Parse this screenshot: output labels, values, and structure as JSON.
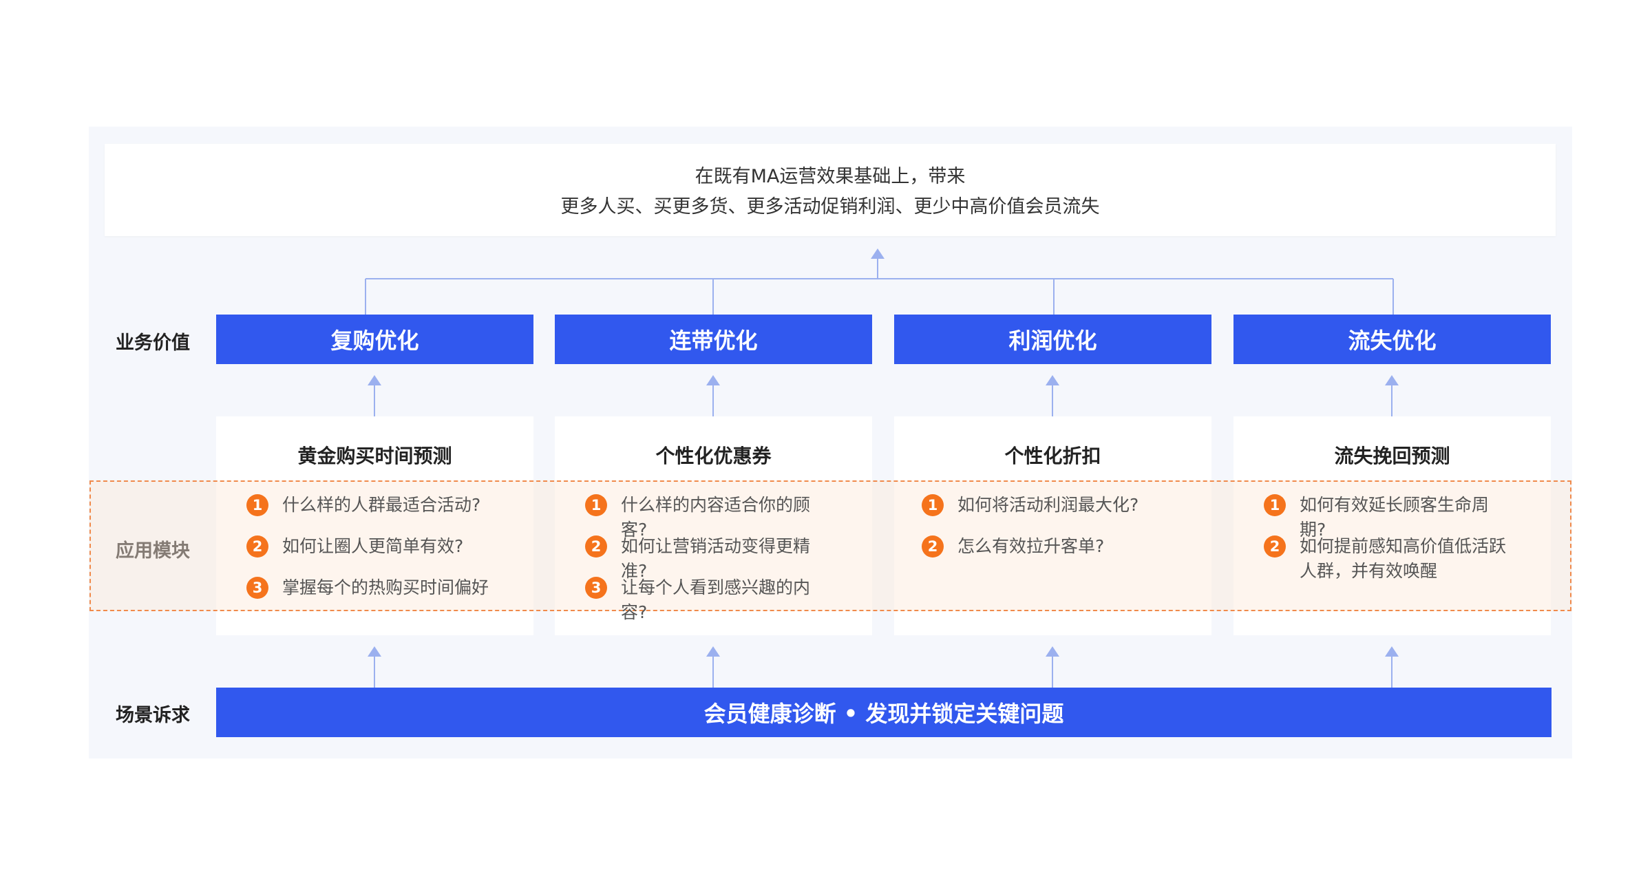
{
  "top": {
    "line1": "在既有MA运营效果基础上，带来",
    "line2": "更多人买、买更多货、更多活动促销利润、更少中高价值会员流失"
  },
  "row_labels": {
    "business_value": "业务价值",
    "app_module": "应用模块",
    "scenario": "场景诉求"
  },
  "value_boxes": [
    "复购优化",
    "连带优化",
    "利润优化",
    "流失优化"
  ],
  "modules": [
    {
      "title": "黄金购买时间预测",
      "items": [
        {
          "num": "1",
          "text": "什么样的人群最适合活动?"
        },
        {
          "num": "2",
          "text": "如何让圈人更简单有效?"
        },
        {
          "num": "3",
          "text": "掌握每个的热购买时间偏好"
        }
      ]
    },
    {
      "title": "个性化优惠券",
      "items": [
        {
          "num": "1",
          "text": "什么样的内容适合你的顾客?"
        },
        {
          "num": "2",
          "text": "如何让营销活动变得更精准?"
        },
        {
          "num": "3",
          "text": "让每个人看到感兴趣的内容?"
        }
      ]
    },
    {
      "title": "个性化折扣",
      "items": [
        {
          "num": "1",
          "text": "如何将活动利润最大化?"
        },
        {
          "num": "2",
          "text": "怎么有效拉升客单?"
        }
      ]
    },
    {
      "title": "流失挽回预测",
      "items": [
        {
          "num": "1",
          "text": "如何有效延长顾客生命周期?"
        },
        {
          "num": "2",
          "text": "如何提前感知高价值低活跃人群，并有效唤醒"
        }
      ]
    }
  ],
  "bottom": {
    "label": "会员健康诊断 • 发现并锁定关键问题"
  },
  "colors": {
    "primary_blue": "#3158ee",
    "connector": "#9bb0ef",
    "badge_orange": "#f5731c",
    "dash_orange": "#f08a4b"
  }
}
